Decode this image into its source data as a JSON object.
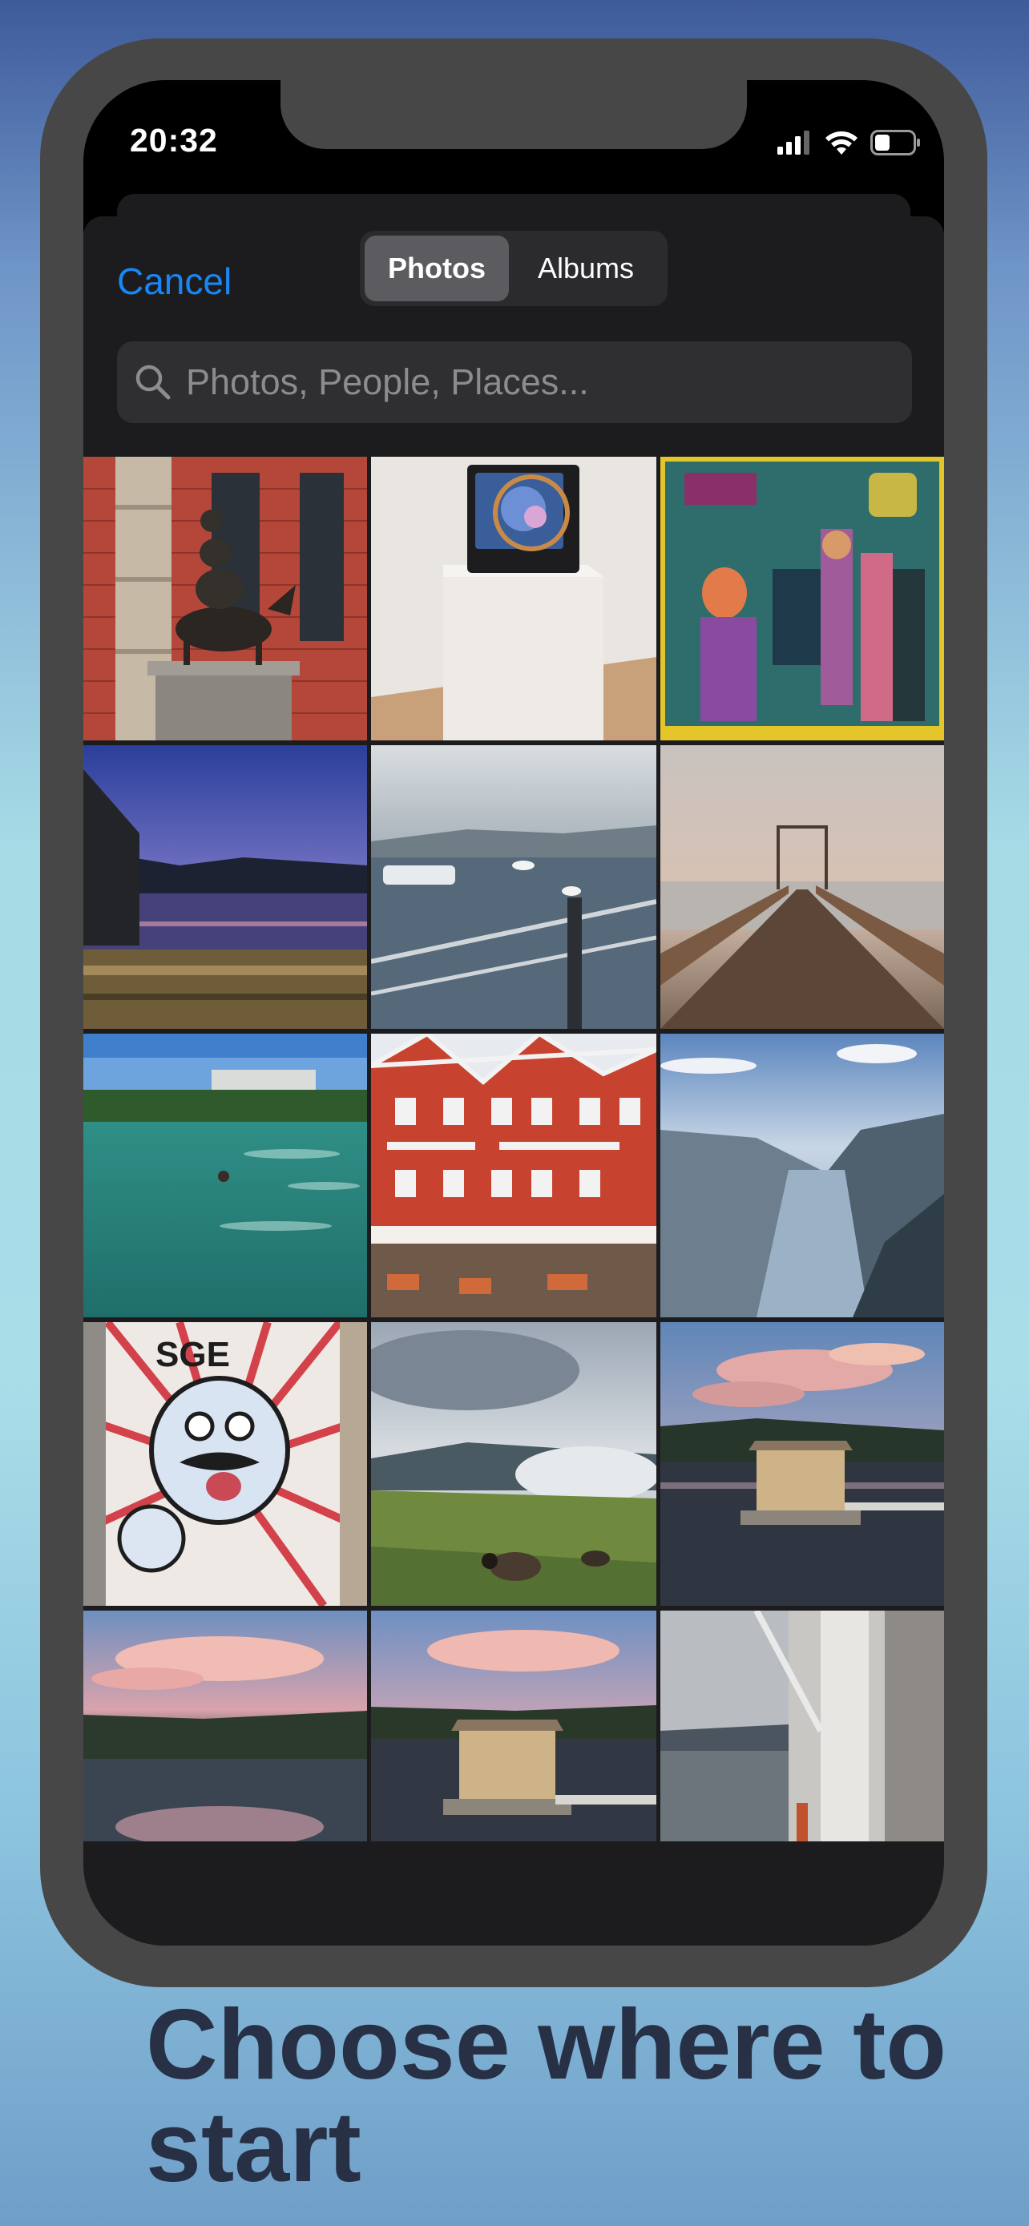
{
  "status_bar": {
    "time": "20:32"
  },
  "picker": {
    "cancel_label": "Cancel",
    "tabs": [
      {
        "label": "Photos",
        "active": true
      },
      {
        "label": "Albums",
        "active": false
      }
    ],
    "search_placeholder": "Photos, People, Places..."
  },
  "photos": [
    {
      "subject": "bremen-town-musicians-statue"
    },
    {
      "subject": "television-sculpture-on-pedestal"
    },
    {
      "subject": "expressionist-street-painting"
    },
    {
      "subject": "river-sunset-city"
    },
    {
      "subject": "harbor-railing-seagulls"
    },
    {
      "subject": "wooden-pier-dusk"
    },
    {
      "subject": "green-lake-swimmer"
    },
    {
      "subject": "red-wooden-facades"
    },
    {
      "subject": "fjord-valley"
    },
    {
      "subject": "street-art-character"
    },
    {
      "subject": "sheep-foggy-hills"
    },
    {
      "subject": "floating-sauna-sunset"
    },
    {
      "subject": "fjord-sunset-reflection"
    },
    {
      "subject": "floating-sauna-wide"
    },
    {
      "subject": "ship-deck-fjord-fog"
    }
  ],
  "tagline": "Choose where to start"
}
